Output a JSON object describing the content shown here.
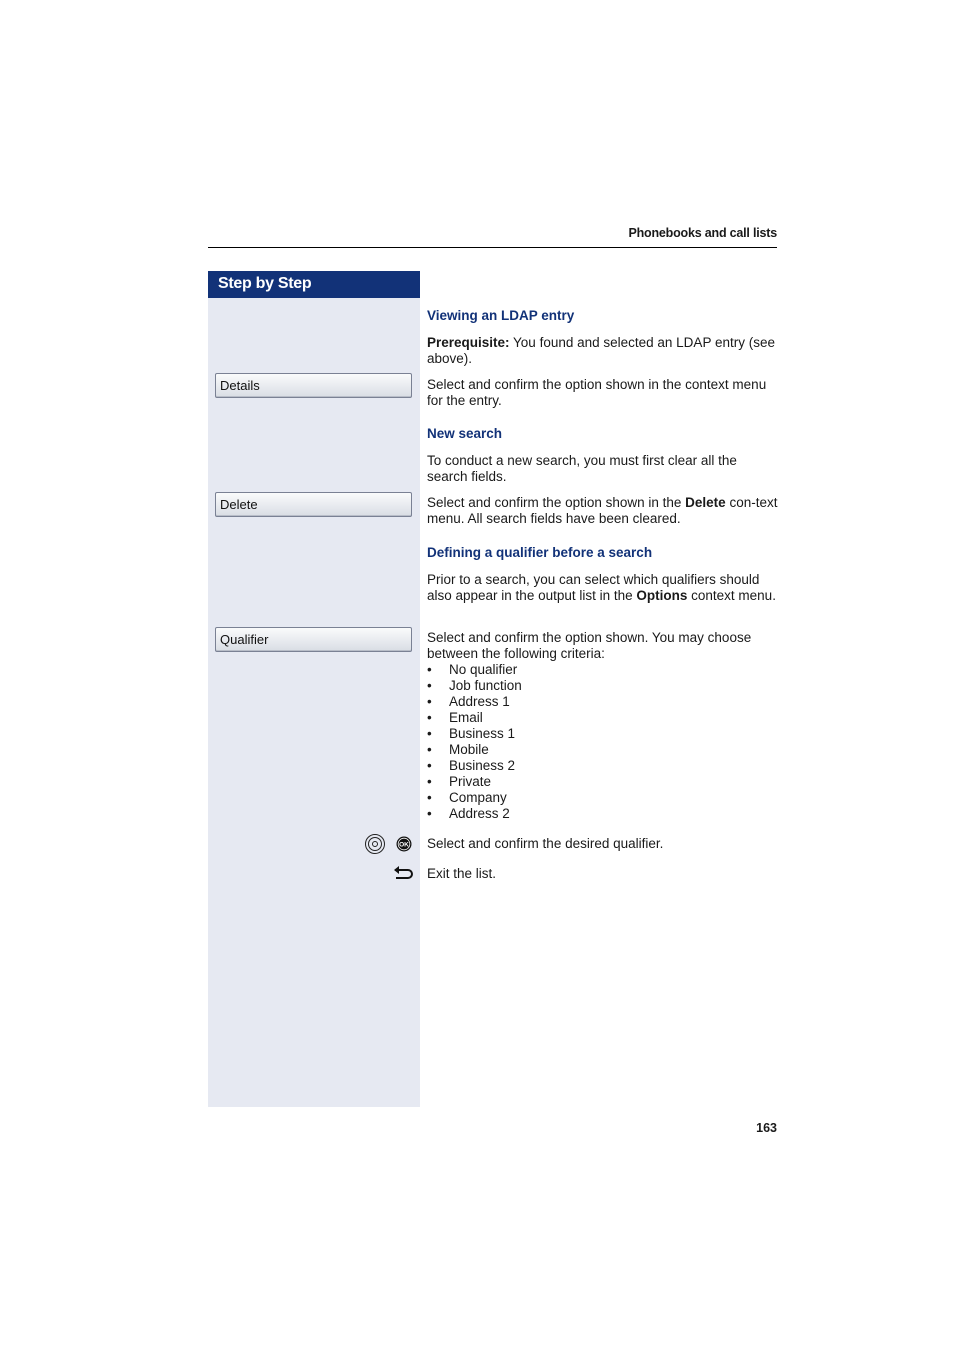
{
  "header": {
    "title": "Phonebooks and call lists"
  },
  "sidebar": {
    "title": "Step by Step"
  },
  "buttons": {
    "details": "Details",
    "delete": "Delete",
    "qualifier": "Qualifier"
  },
  "sections": {
    "viewing": {
      "heading": "Viewing an LDAP entry",
      "prereq_label": "Prerequisite:",
      "prereq_text": " You found and selected an LDAP entry (see above).",
      "instruction": "Select and confirm the option shown in the context menu for the entry."
    },
    "new_search": {
      "heading": "New search",
      "intro": "To conduct a new search, you must first clear all the search fields.",
      "instr_pre": "Select and confirm the option shown in the ",
      "instr_bold": "Delete",
      "instr_post": " con-text menu. All search fields have been cleared."
    },
    "qualifier": {
      "heading": "Defining a qualifier before a search",
      "intro_pre": "Prior to a search, you can select which qualifiers should also appear in the output list in the ",
      "intro_bold": "Options",
      "intro_post": " context menu.",
      "instruction": "Select and confirm the option shown. You may choose between the following criteria:",
      "criteria": [
        "No qualifier",
        "Job function",
        "Address 1",
        "Email",
        "Business 1",
        "Mobile",
        "Business 2",
        "Private",
        "Company",
        "Address 2"
      ],
      "confirm_text": "Select and confirm the desired qualifier.",
      "exit_text": "Exit the list."
    }
  },
  "icons": {
    "navigator": "navigator-icon",
    "ok": "ok-key-icon",
    "back": "back-key-icon"
  },
  "page_number": "163"
}
